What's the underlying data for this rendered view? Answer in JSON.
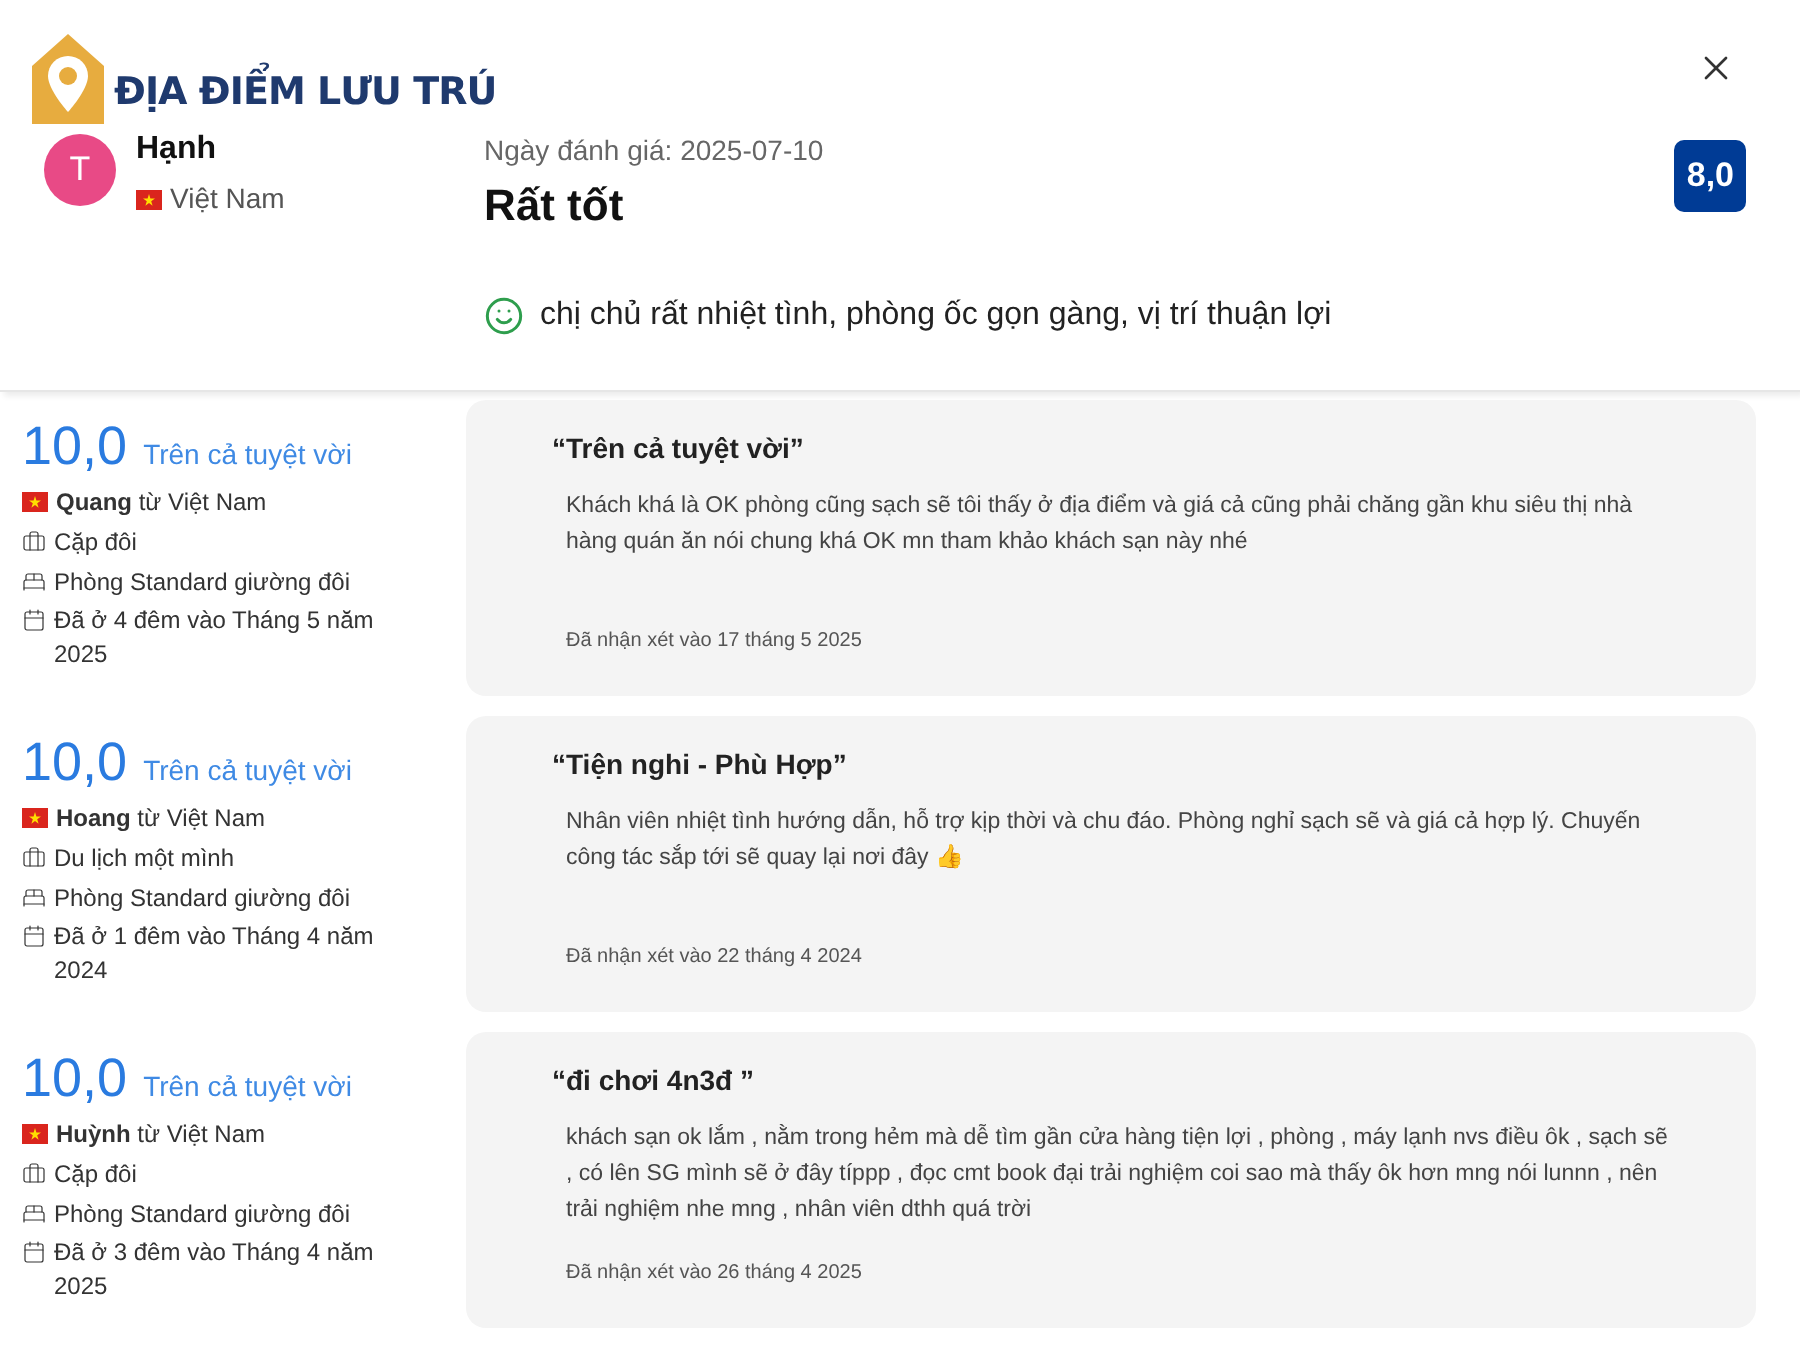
{
  "logo": {
    "text": "ĐỊA ĐIỂM LƯU TRÚ"
  },
  "featured_review": {
    "avatar_letter": "T",
    "name": "Hạnh",
    "country": "Việt Nam",
    "date": "Ngày đánh giá: 2025-07-10",
    "rating_label": "Rất tốt",
    "score": "8,0",
    "positive_comment": "chị chủ rất nhiệt tình, phòng ốc gọn gàng, vị trí thuận lợi"
  },
  "reviews": [
    {
      "score": "10,0",
      "score_label": "Trên cả tuyệt vời",
      "reviewer": "**Quang** từ Việt Nam",
      "traveler_type": "Cặp đôi",
      "room": "Phòng Standard giường đôi",
      "stay": "Đã ở 4 đêm vào Tháng 5 năm 2025",
      "title": "“Trên cả tuyệt vời”",
      "body": "Khách khá là OK phòng cũng sạch sẽ tôi thấy ở địa điểm và giá cả cũng phải chăng gần khu siêu thị nhà hàng quán ăn nói chung khá OK mn tham khảo khách sạn này nhé",
      "reviewed": "Đã nhận xét vào 17 tháng 5 2025"
    },
    {
      "score": "10,0",
      "score_label": "Trên cả tuyệt vời",
      "reviewer": "**Hoang** từ Việt Nam",
      "traveler_type": "Du lịch một mình",
      "room": "Phòng Standard giường đôi",
      "stay": "Đã ở 1 đêm vào Tháng 4 năm 2024",
      "title": "“Tiện nghi - Phù Hợp”",
      "body": "Nhân viên nhiệt tình hướng dẫn, hỗ trợ kịp thời và chu đáo. Phòng nghỉ sạch sẽ và giá cả hợp lý. Chuyến công tác sắp tới sẽ quay lại nơi đây 👍",
      "reviewed": "Đã nhận xét vào 22 tháng 4 2024"
    },
    {
      "score": "10,0",
      "score_label": "Trên cả tuyệt vời",
      "reviewer": "**Huỳnh** từ Việt Nam",
      "traveler_type": "Cặp đôi",
      "room": "Phòng Standard giường đôi",
      "stay": "Đã ở 3 đêm vào Tháng 4 năm 2025",
      "title": "“đi chơi 4n3đ ”",
      "body": "khách sạn ok lắm , nằm trong hẻm mà dễ tìm gần cửa hàng tiện lợi , phòng , máy lạnh nvs điều ôk , sạch sẽ , có lên SG mình sẽ ở đây típpp , đọc cmt book đại trải nghiệm coi sao mà thấy ôk hơn mng nói lunnn , nên trải nghiệm nhe mng , nhân viên dthh quá trời",
      "reviewed": "Đã nhận xét vào 26 tháng 4 2025"
    }
  ]
}
